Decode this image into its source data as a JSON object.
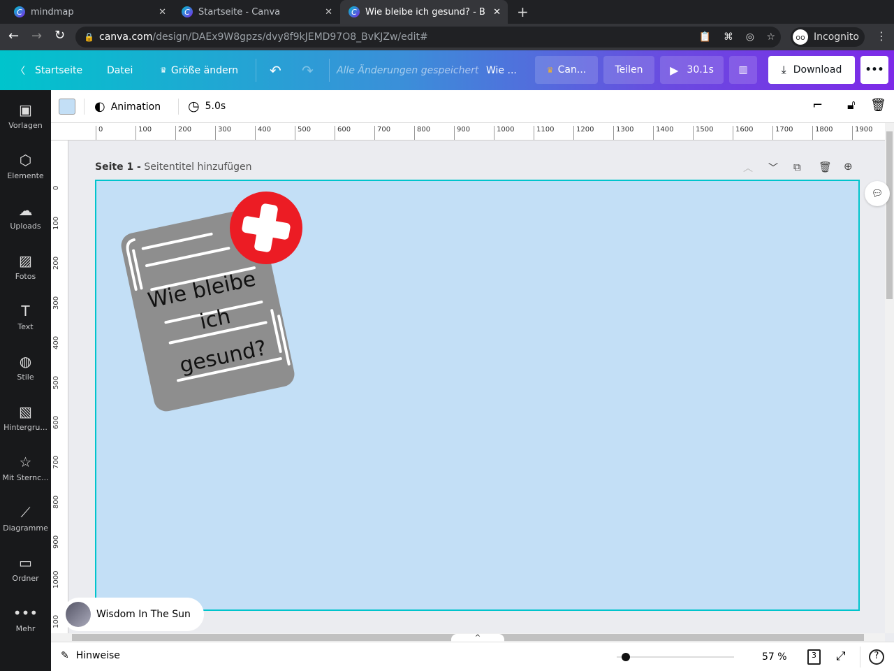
{
  "browser": {
    "tabs": [
      {
        "title": "mindmap"
      },
      {
        "title": "Startseite - Canva"
      },
      {
        "title": "Wie bleibe ich gesund? - B"
      }
    ],
    "url_host": "canva.com",
    "url_path": "/design/DAEx9W8gpzs/dvy8f9kJEMD97O8_BvKJZw/edit#",
    "profile": "Incognito"
  },
  "topbar": {
    "home": "Startseite",
    "file": "Datei",
    "resize": "Größe ändern",
    "saved": "Alle Änderungen gespeichert",
    "title": "Wie ...",
    "canva_pro": "Can...",
    "share": "Teilen",
    "play": "30.1s",
    "download": "Download"
  },
  "sidebar": {
    "items": [
      {
        "label": "Vorlagen",
        "icon": "▣"
      },
      {
        "label": "Elemente",
        "icon": "⬡"
      },
      {
        "label": "Uploads",
        "icon": "☁"
      },
      {
        "label": "Fotos",
        "icon": "▨"
      },
      {
        "label": "Text",
        "icon": "T"
      },
      {
        "label": "Stile",
        "icon": "◍"
      },
      {
        "label": "Hintergru...",
        "icon": "▧"
      },
      {
        "label": "Mit Sternc...",
        "icon": "☆"
      },
      {
        "label": "Diagramme",
        "icon": "⟋"
      },
      {
        "label": "Ordner",
        "icon": "▭"
      },
      {
        "label": "Mehr",
        "icon": "•••"
      }
    ]
  },
  "toolbar": {
    "background_color": "#c3dff6",
    "animation": "Animation",
    "duration": "5.0s"
  },
  "ruler": {
    "h": [
      "0",
      "100",
      "200",
      "300",
      "400",
      "500",
      "600",
      "700",
      "800",
      "900",
      "1000",
      "1100",
      "1200",
      "1300",
      "1400",
      "1500",
      "1600",
      "1700",
      "1800",
      "1900"
    ],
    "v": [
      "0",
      "100",
      "200",
      "300",
      "400",
      "500",
      "600",
      "700",
      "800",
      "900",
      "1000",
      "100"
    ]
  },
  "page": {
    "label": "Seite 1 -",
    "title_placeholder": "Seitentitel hinzufügen",
    "text_lines": [
      "Wie bleibe",
      "ich",
      "gesund?"
    ]
  },
  "presence": {
    "name": "Wisdom In The Sun"
  },
  "bottom": {
    "notes": "Hinweise",
    "zoom": "57 %",
    "zoom_value": 57,
    "pages": "3"
  }
}
